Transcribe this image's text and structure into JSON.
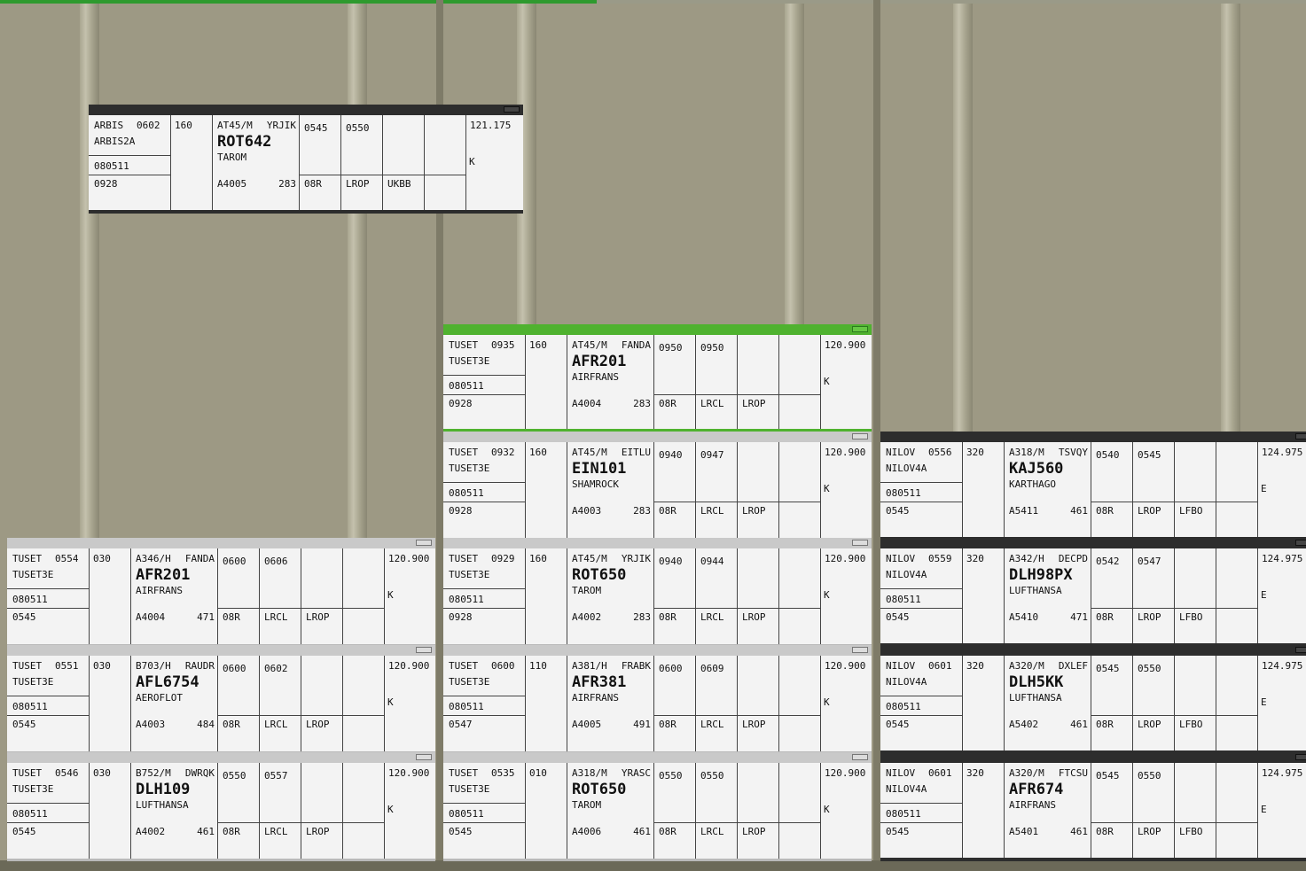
{
  "top_progress": 0.457,
  "colors": {
    "background": "#9d9984",
    "strip_body": "#f3f3f3",
    "header_light": "#c9c9c9",
    "header_dark": "#2d2d2d",
    "header_selected": "#4fb22f",
    "ink": "#111111"
  },
  "strips": [
    {
      "style": "dark",
      "fix": "ARBIS",
      "eto": "0602",
      "route": "ARBIS2A",
      "date": "080511",
      "time": "0928",
      "cfl": "160",
      "type": "AT45/M",
      "squawk": "YRJIK",
      "callsign": "ROT642",
      "company": "TAROM",
      "reg": "A4005",
      "speed": "283",
      "t1": "0545",
      "t2": "0550",
      "runway": "08R",
      "dest": "LROP",
      "extra": "UKBB",
      "freq": "121.175",
      "letter": "K",
      "icon": "drag-grip-icon"
    },
    {
      "style": "selected",
      "fix": "TUSET",
      "eto": "0935",
      "route": "TUSET3E",
      "date": "080511",
      "time": "0928",
      "cfl": "160",
      "type": "AT45/M",
      "squawk": "FANDA",
      "callsign": "AFR201",
      "company": "AIRFRANS",
      "reg": "A4004",
      "speed": "283",
      "t1": "0950",
      "t2": "0950",
      "runway": "08R",
      "dest": "LRCL",
      "extra": "LROP",
      "freq": "120.900",
      "letter": "K",
      "icon": "drag-grip-icon"
    },
    {
      "style": "light",
      "fix": "TUSET",
      "eto": "0932",
      "route": "TUSET3E",
      "date": "080511",
      "time": "0928",
      "cfl": "160",
      "type": "AT45/M",
      "squawk": "EITLU",
      "callsign": "EIN101",
      "company": "SHAMROCK",
      "reg": "A4003",
      "speed": "283",
      "t1": "0940",
      "t2": "0947",
      "runway": "08R",
      "dest": "LRCL",
      "extra": "LROP",
      "freq": "120.900",
      "letter": "K",
      "icon": "drag-grip-icon"
    },
    {
      "style": "light",
      "fix": "TUSET",
      "eto": "0929",
      "route": "TUSET3E",
      "date": "080511",
      "time": "0928",
      "cfl": "160",
      "type": "AT45/M",
      "squawk": "YRJIK",
      "callsign": "ROT650",
      "company": "TAROM",
      "reg": "A4002",
      "speed": "283",
      "t1": "0940",
      "t2": "0944",
      "runway": "08R",
      "dest": "LRCL",
      "extra": "LROP",
      "freq": "120.900",
      "letter": "K",
      "icon": "drag-grip-icon"
    },
    {
      "style": "light",
      "fix": "TUSET",
      "eto": "0600",
      "route": "TUSET3E",
      "date": "080511",
      "time": "0547",
      "cfl": "110",
      "type": "A381/H",
      "squawk": "FRABK",
      "callsign": "AFR381",
      "company": "AIRFRANS",
      "reg": "A4005",
      "speed": "491",
      "t1": "0600",
      "t2": "0609",
      "runway": "08R",
      "dest": "LRCL",
      "extra": "LROP",
      "freq": "120.900",
      "letter": "K",
      "icon": "drag-grip-icon"
    },
    {
      "style": "light",
      "fix": "TUSET",
      "eto": "0535",
      "route": "TUSET3E",
      "date": "080511",
      "time": "0545",
      "cfl": "010",
      "type": "A318/M",
      "squawk": "YRASC",
      "callsign": "ROT650",
      "company": "TAROM",
      "reg": "A4006",
      "speed": "461",
      "t1": "0550",
      "t2": "0550",
      "runway": "08R",
      "dest": "LRCL",
      "extra": "LROP",
      "freq": "120.900",
      "letter": "K",
      "icon": "drag-grip-icon"
    },
    {
      "style": "light",
      "fix": "TUSET",
      "eto": "0554",
      "route": "TUSET3E",
      "date": "080511",
      "time": "0545",
      "cfl": "030",
      "type": "A346/H",
      "squawk": "FANDA",
      "callsign": "AFR201",
      "company": "AIRFRANS",
      "reg": "A4004",
      "speed": "471",
      "t1": "0600",
      "t2": "0606",
      "runway": "08R",
      "dest": "LRCL",
      "extra": "LROP",
      "freq": "120.900",
      "letter": "K",
      "icon": "drag-grip-icon"
    },
    {
      "style": "light",
      "fix": "TUSET",
      "eto": "0551",
      "route": "TUSET3E",
      "date": "080511",
      "time": "0545",
      "cfl": "030",
      "type": "B703/H",
      "squawk": "RAUDR",
      "callsign": "AFL6754",
      "company": "AEROFLOT",
      "reg": "A4003",
      "speed": "484",
      "t1": "0600",
      "t2": "0602",
      "runway": "08R",
      "dest": "LRCL",
      "extra": "LROP",
      "freq": "120.900",
      "letter": "K",
      "icon": "drag-grip-icon"
    },
    {
      "style": "light",
      "fix": "TUSET",
      "eto": "0546",
      "route": "TUSET3E",
      "date": "080511",
      "time": "0545",
      "cfl": "030",
      "type": "B752/M",
      "squawk": "DWRQK",
      "callsign": "DLH109",
      "company": "LUFTHANSA",
      "reg": "A4002",
      "speed": "461",
      "t1": "0550",
      "t2": "0557",
      "runway": "08R",
      "dest": "LRCL",
      "extra": "LROP",
      "freq": "120.900",
      "letter": "K",
      "icon": "drag-grip-icon"
    },
    {
      "style": "dark",
      "fix": "NILOV",
      "eto": "0556",
      "route": "NILOV4A",
      "date": "080511",
      "time": "0545",
      "cfl": "320",
      "type": "A318/M",
      "squawk": "TSVQY",
      "callsign": "KAJ560",
      "company": "KARTHAGO",
      "reg": "A5411",
      "speed": "461",
      "t1": "0540",
      "t2": "0545",
      "runway": "08R",
      "dest": "LROP",
      "extra": "LFBO",
      "freq": "124.975",
      "letter": "E",
      "icon": "drag-grip-icon"
    },
    {
      "style": "dark",
      "fix": "NILOV",
      "eto": "0559",
      "route": "NILOV4A",
      "date": "080511",
      "time": "0545",
      "cfl": "320",
      "type": "A342/H",
      "squawk": "DECPD",
      "callsign": "DLH98PX",
      "company": "LUFTHANSA",
      "reg": "A5410",
      "speed": "471",
      "t1": "0542",
      "t2": "0547",
      "runway": "08R",
      "dest": "LROP",
      "extra": "LFBO",
      "freq": "124.975",
      "letter": "E",
      "icon": "drag-grip-icon"
    },
    {
      "style": "dark",
      "fix": "NILOV",
      "eto": "0601",
      "route": "NILOV4A",
      "date": "080511",
      "time": "0545",
      "cfl": "320",
      "type": "A320/M",
      "squawk": "DXLEF",
      "callsign": "DLH5KK",
      "company": "LUFTHANSA",
      "reg": "A5402",
      "speed": "461",
      "t1": "0545",
      "t2": "0550",
      "runway": "08R",
      "dest": "LROP",
      "extra": "LFBO",
      "freq": "124.975",
      "letter": "E",
      "icon": "drag-grip-icon"
    },
    {
      "style": "dark",
      "fix": "NILOV",
      "eto": "0601",
      "route": "NILOV4A",
      "date": "080511",
      "time": "0545",
      "cfl": "320",
      "type": "A320/M",
      "squawk": "FTCSU",
      "callsign": "AFR674",
      "company": "AIRFRANS",
      "reg": "A5401",
      "speed": "461",
      "t1": "0545",
      "t2": "0550",
      "runway": "08R",
      "dest": "LROP",
      "extra": "LFBO",
      "freq": "124.975",
      "letter": "E",
      "icon": "drag-grip-icon"
    }
  ]
}
